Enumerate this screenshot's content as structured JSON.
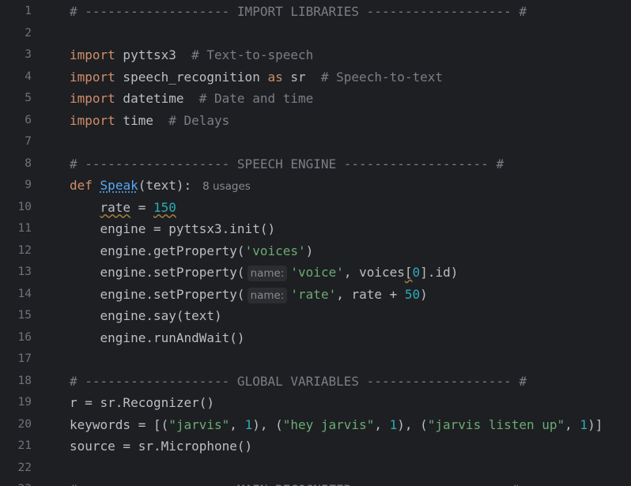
{
  "editor": {
    "lines": [
      {
        "n": "1",
        "segs": [
          {
            "t": "# ------------------- IMPORT LIBRARIES ------------------- #",
            "c": "cm"
          }
        ]
      },
      {
        "n": "2",
        "segs": []
      },
      {
        "n": "3",
        "segs": [
          {
            "t": "import",
            "c": "kw"
          },
          {
            "t": " pyttsx3  ",
            "c": ""
          },
          {
            "t": "# Text-to-speech",
            "c": "cm"
          }
        ]
      },
      {
        "n": "4",
        "segs": [
          {
            "t": "import",
            "c": "kw"
          },
          {
            "t": " speech_recognition ",
            "c": ""
          },
          {
            "t": "as",
            "c": "kw"
          },
          {
            "t": " sr  ",
            "c": ""
          },
          {
            "t": "# Speech-to-text",
            "c": "cm"
          }
        ]
      },
      {
        "n": "5",
        "segs": [
          {
            "t": "import",
            "c": "kw"
          },
          {
            "t": " datetime  ",
            "c": ""
          },
          {
            "t": "# Date and time",
            "c": "cm"
          }
        ]
      },
      {
        "n": "6",
        "segs": [
          {
            "t": "import",
            "c": "kw"
          },
          {
            "t": " time  ",
            "c": ""
          },
          {
            "t": "# Delays",
            "c": "cm"
          }
        ]
      },
      {
        "n": "7",
        "segs": []
      },
      {
        "n": "8",
        "segs": [
          {
            "t": "# ------------------- SPEECH ENGINE ------------------- #",
            "c": "cm"
          }
        ]
      },
      {
        "n": "9",
        "segs": [
          {
            "t": "def",
            "c": "kw"
          },
          {
            "t": " ",
            "c": ""
          },
          {
            "t": "Speak",
            "c": "fn"
          },
          {
            "t": "(text):",
            "c": ""
          },
          {
            "t": "8 usages",
            "c": "hint-usage"
          }
        ]
      },
      {
        "n": "10",
        "segs": [
          {
            "t": "    ",
            "c": ""
          },
          {
            "t": "rate",
            "c": "squiggle"
          },
          {
            "t": " = ",
            "c": ""
          },
          {
            "t": "150",
            "c": "num squiggle"
          }
        ]
      },
      {
        "n": "11",
        "segs": [
          {
            "t": "    engine = pyttsx3.init()",
            "c": ""
          }
        ]
      },
      {
        "n": "12",
        "segs": [
          {
            "t": "    engine.getProperty(",
            "c": ""
          },
          {
            "t": "'voices'",
            "c": "str"
          },
          {
            "t": ")",
            "c": ""
          }
        ]
      },
      {
        "n": "13",
        "segs": [
          {
            "t": "    engine.setProperty(",
            "c": ""
          },
          {
            "t": "name:",
            "c": "hint-param"
          },
          {
            "t": "'voice'",
            "c": "str"
          },
          {
            "t": ", voices",
            "c": ""
          },
          {
            "t": "[",
            "c": "mark-under"
          },
          {
            "t": "0",
            "c": "num"
          },
          {
            "t": "].id)",
            "c": ""
          }
        ]
      },
      {
        "n": "14",
        "segs": [
          {
            "t": "    engine.setProperty(",
            "c": ""
          },
          {
            "t": "name:",
            "c": "hint-param"
          },
          {
            "t": "'rate'",
            "c": "str"
          },
          {
            "t": ", rate + ",
            "c": ""
          },
          {
            "t": "50",
            "c": "num"
          },
          {
            "t": ")",
            "c": ""
          }
        ]
      },
      {
        "n": "15",
        "segs": [
          {
            "t": "    engine.say(text)",
            "c": ""
          }
        ]
      },
      {
        "n": "16",
        "segs": [
          {
            "t": "    engine.runAndWait()",
            "c": ""
          }
        ]
      },
      {
        "n": "17",
        "segs": []
      },
      {
        "n": "18",
        "segs": [
          {
            "t": "# ------------------- GLOBAL VARIABLES ------------------- #",
            "c": "cm"
          }
        ]
      },
      {
        "n": "19",
        "segs": [
          {
            "t": "r = sr.Recognizer()",
            "c": ""
          }
        ]
      },
      {
        "n": "20",
        "segs": [
          {
            "t": "keywords = [(",
            "c": ""
          },
          {
            "t": "\"jarvis\"",
            "c": "str"
          },
          {
            "t": ", ",
            "c": ""
          },
          {
            "t": "1",
            "c": "num"
          },
          {
            "t": "), (",
            "c": ""
          },
          {
            "t": "\"hey jarvis\"",
            "c": "str"
          },
          {
            "t": ", ",
            "c": ""
          },
          {
            "t": "1",
            "c": "num"
          },
          {
            "t": "), (",
            "c": ""
          },
          {
            "t": "\"jarvis listen up\"",
            "c": "str"
          },
          {
            "t": ", ",
            "c": ""
          },
          {
            "t": "1",
            "c": "num"
          },
          {
            "t": ")]",
            "c": ""
          }
        ]
      },
      {
        "n": "21",
        "segs": [
          {
            "t": "source = sr.Microphone()",
            "c": ""
          }
        ]
      },
      {
        "n": "22",
        "segs": []
      },
      {
        "n": "23",
        "segs": [
          {
            "t": "# ------------------- MAIN RECOGNIZER ------------------- #",
            "c": "cm"
          }
        ]
      }
    ]
  },
  "colors": {
    "background": "#1e1f22",
    "keyword": "#cf8e6d",
    "comment": "#7a7e85",
    "string": "#6aab73",
    "number": "#2aacb8",
    "function": "#56a8f5",
    "line_number": "#6f737a"
  }
}
